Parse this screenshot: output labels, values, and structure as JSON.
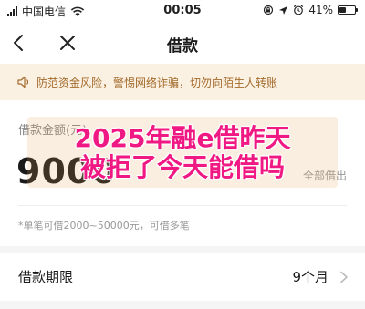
{
  "status_bar": {
    "carrier": "中国电信",
    "time": "00:05",
    "battery_percent": "41%",
    "battery_level": 0.41,
    "icons": [
      "signal-icon",
      "wifi-icon",
      "screen-lock-icon",
      "location-icon",
      "alarm-icon",
      "battery-icon"
    ]
  },
  "nav": {
    "title": "借款",
    "icons": [
      "back-arrow-icon",
      "close-icon"
    ]
  },
  "notice": {
    "icon": "speaker-icon",
    "text": "防范资金风险，警惕网络诈骗，切勿向陌生人转账",
    "color": "#a36a2a",
    "background": "#fbf1e3"
  },
  "amount": {
    "label": "借款金额(元)",
    "value": "9000",
    "all_button": "全部借出",
    "hint": "*单笔可借2000~50000元，可借多笔"
  },
  "overlay": {
    "line1": "2025年融e借昨天",
    "line2": "被拒了今天能借吗",
    "color": "#f01883"
  },
  "term": {
    "label": "借款期限",
    "value": "9个月",
    "icon": "chevron-right-icon"
  }
}
